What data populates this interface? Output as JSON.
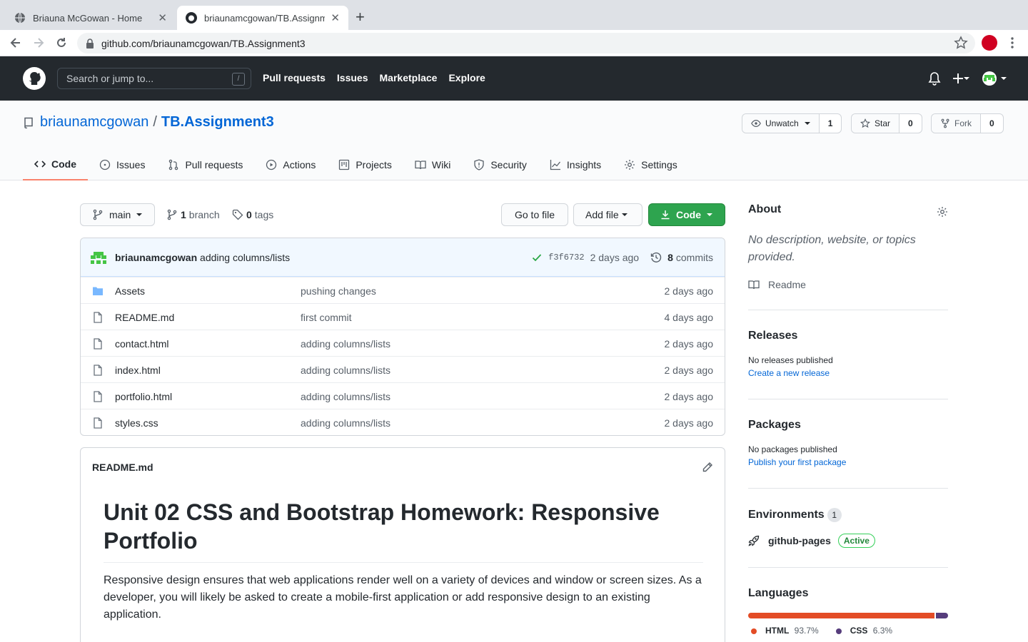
{
  "browser": {
    "tabs": [
      {
        "title": "Briauna McGowan - Home",
        "active": false
      },
      {
        "title": "briaunamcgowan/TB.Assignme",
        "active": true
      }
    ],
    "url": "github.com/briaunamcgowan/TB.Assignment3"
  },
  "gh_header": {
    "search_placeholder": "Search or jump to...",
    "search_shortcut": "/",
    "nav": [
      "Pull requests",
      "Issues",
      "Marketplace",
      "Explore"
    ]
  },
  "repo": {
    "owner": "briaunamcgowan",
    "separator": "/",
    "name": "TB.Assignment3",
    "watch": {
      "label": "Unwatch",
      "count": "1"
    },
    "star": {
      "label": "Star",
      "count": "0"
    },
    "fork": {
      "label": "Fork",
      "count": "0"
    },
    "tabs": [
      "Code",
      "Issues",
      "Pull requests",
      "Actions",
      "Projects",
      "Wiki",
      "Security",
      "Insights",
      "Settings"
    ]
  },
  "file_nav": {
    "branch": "main",
    "branch_count": "1",
    "branch_label": "branch",
    "tag_count": "0",
    "tag_label": "tags",
    "go_to_file": "Go to file",
    "add_file": "Add file",
    "code": "Code"
  },
  "latest_commit": {
    "author": "briaunamcgowan",
    "message": "adding columns/lists",
    "sha": "f3f6732",
    "age": "2 days ago",
    "commit_count": "8",
    "commits_label": "commits"
  },
  "files": [
    {
      "name": "Assets",
      "type": "dir",
      "message": "pushing changes",
      "age": "2 days ago"
    },
    {
      "name": "README.md",
      "type": "file",
      "message": "first commit",
      "age": "4 days ago"
    },
    {
      "name": "contact.html",
      "type": "file",
      "message": "adding columns/lists",
      "age": "2 days ago"
    },
    {
      "name": "index.html",
      "type": "file",
      "message": "adding columns/lists",
      "age": "2 days ago"
    },
    {
      "name": "portfolio.html",
      "type": "file",
      "message": "adding columns/lists",
      "age": "2 days ago"
    },
    {
      "name": "styles.css",
      "type": "file",
      "message": "adding columns/lists",
      "age": "2 days ago"
    }
  ],
  "readme": {
    "filename": "README.md",
    "title": "Unit 02 CSS and Bootstrap Homework: Responsive Portfolio",
    "paragraph": "Responsive design ensures that web applications render well on a variety of devices and window or screen sizes. As a developer, you will likely be asked to create a mobile-first application or add responsive design to an existing application."
  },
  "sidebar": {
    "about_title": "About",
    "about_text": "No description, website, or topics provided.",
    "readme_link": "Readme",
    "releases_title": "Releases",
    "releases_text": "No releases published",
    "releases_link": "Create a new release",
    "packages_title": "Packages",
    "packages_text": "No packages published",
    "packages_link": "Publish your first package",
    "environments_title": "Environments",
    "environments_count": "1",
    "environment_name": "github-pages",
    "environment_status": "Active",
    "languages_title": "Languages",
    "languages": [
      {
        "name": "HTML",
        "percent": "93.7%",
        "value": 93.7,
        "color": "#e34c26"
      },
      {
        "name": "CSS",
        "percent": "6.3%",
        "value": 6.3,
        "color": "#563d7c"
      }
    ]
  },
  "colors": {
    "link": "#0366d6",
    "green_button": "#2ea44f",
    "header_bg": "#24292e",
    "active_tab_underline": "#f9826c"
  }
}
